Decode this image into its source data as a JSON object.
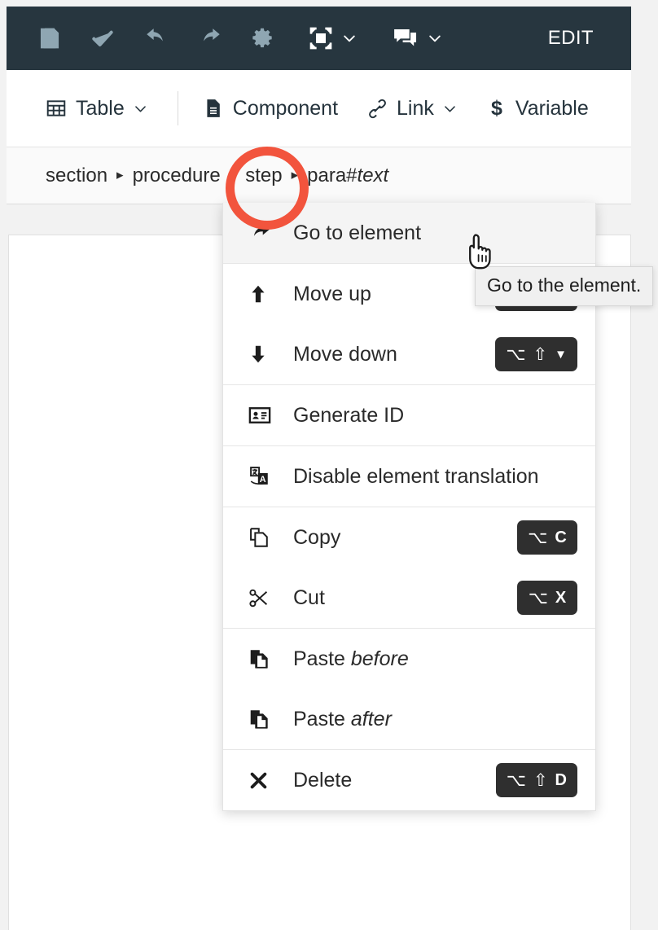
{
  "header": {
    "buttons": [
      {
        "name": "save-icon",
        "label": "Save"
      },
      {
        "name": "validate-icon",
        "label": "Validate"
      },
      {
        "name": "undo-icon",
        "label": "Undo"
      },
      {
        "name": "redo-icon",
        "label": "Redo"
      },
      {
        "name": "settings-icon",
        "label": "Settings"
      },
      {
        "name": "fullscreen-icon",
        "label": "Fullscreen"
      },
      {
        "name": "comments-icon",
        "label": "Comments"
      }
    ],
    "edit_label": "EDIT"
  },
  "toolbar": {
    "table_label": "Table",
    "component_label": "Component",
    "link_label": "Link",
    "variable_label": "Variable"
  },
  "breadcrumb": {
    "items": [
      {
        "text": "section"
      },
      {
        "text": "procedure"
      },
      {
        "text": "step"
      },
      {
        "text": "para#",
        "italic_tail": "text"
      }
    ],
    "separator": "▸"
  },
  "context_menu": {
    "groups": [
      {
        "items": [
          {
            "label": "Go to element",
            "icon": "go-to-element-icon",
            "shortcut": [],
            "hovered": true
          }
        ]
      },
      {
        "items": [
          {
            "label": "Move up",
            "icon": "arrow-up-icon",
            "shortcut": [
              "⌥",
              "⇧",
              "▲"
            ]
          },
          {
            "label": "Move down",
            "icon": "arrow-down-icon",
            "shortcut": [
              "⌥",
              "⇧",
              "▼"
            ]
          }
        ]
      },
      {
        "items": [
          {
            "label": "Generate ID",
            "icon": "id-card-icon",
            "shortcut": []
          }
        ]
      },
      {
        "items": [
          {
            "label": "Disable element translation",
            "icon": "translate-icon",
            "shortcut": []
          }
        ]
      },
      {
        "items": [
          {
            "label": "Copy",
            "icon": "copy-icon",
            "shortcut": [
              "⌥",
              "C"
            ]
          },
          {
            "label": "Cut",
            "icon": "scissors-icon",
            "shortcut": [
              "⌥",
              "X"
            ]
          }
        ]
      },
      {
        "items": [
          {
            "label": "Paste ",
            "italic_tail": "before",
            "icon": "paste-icon",
            "shortcut": []
          },
          {
            "label": "Paste ",
            "italic_tail": "after",
            "icon": "paste-icon",
            "shortcut": []
          }
        ]
      },
      {
        "items": [
          {
            "label": "Delete",
            "icon": "close-x-icon",
            "shortcut": [
              "⌥",
              "⇧",
              "D"
            ]
          }
        ]
      }
    ]
  },
  "tooltip": {
    "text": "Go to the element."
  },
  "colors": {
    "header_bg": "#27363f",
    "header_icon": "#8fa6b2",
    "annotation": "#f2543d",
    "shortcut_bg": "#2f2f2f",
    "page_bg": "#f2f2f2",
    "hover_bg": "#f4f4f4"
  }
}
